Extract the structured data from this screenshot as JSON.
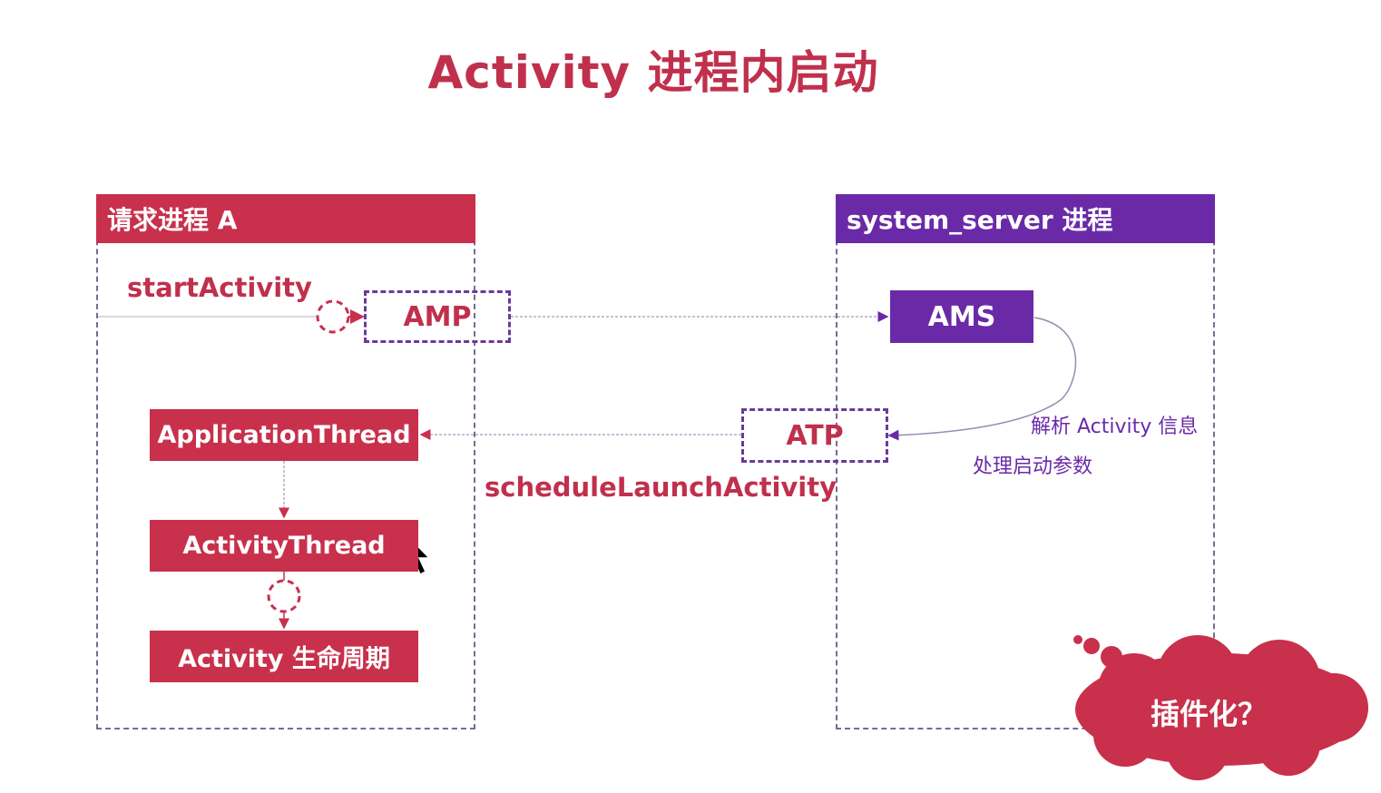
{
  "title": "Activity 进程内启动",
  "process_a": {
    "header": "请求进程 A",
    "start_activity": "startActivity",
    "amp": "AMP",
    "application_thread": "ApplicationThread",
    "activity_thread": "ActivityThread",
    "activity_lifecycle": "Activity 生命周期"
  },
  "system_server": {
    "header": "system_server 进程",
    "ams": "AMS",
    "atp": "ATP",
    "note_line1": "解析 Activity 信息",
    "note_line2": "处理启动参数"
  },
  "schedule_label": "scheduleLaunchActivity",
  "bubble_text": "插件化？",
  "colors": {
    "red": "#c8304c",
    "purple": "#6a2aa8",
    "dashed_border": "#7a6a90"
  }
}
